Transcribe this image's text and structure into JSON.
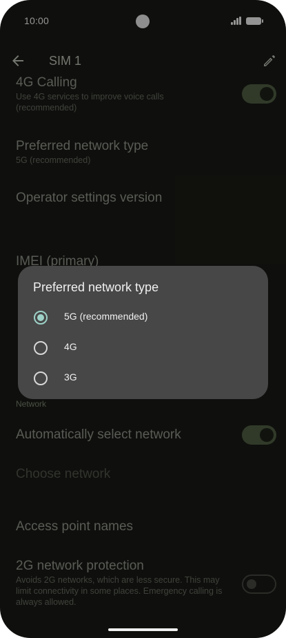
{
  "status_bar": {
    "time": "10:00"
  },
  "app_bar": {
    "title": "SIM 1",
    "back_icon": "arrow-back-icon",
    "edit_icon": "pencil-icon"
  },
  "settings": {
    "calling_4g": {
      "title": "4G Calling",
      "subtitle": "Use 4G services to improve voice calls (recommended)",
      "toggle_on": true
    },
    "preferred_network": {
      "title": "Preferred network type",
      "subtitle": "5G (recommended)"
    },
    "operator_version": {
      "title": "Operator settings version"
    },
    "imei": {
      "title": "IMEI (primary)"
    },
    "network_section": "Network",
    "auto_select": {
      "title": "Automatically select network",
      "toggle_on": true
    },
    "choose_network": {
      "title": "Choose network"
    },
    "apn": {
      "title": "Access point names"
    },
    "protection_2g": {
      "title": "2G network protection",
      "subtitle": "Avoids 2G networks, which are less secure. This may limit connectivity in some places. Emergency calling is always allowed.",
      "toggle_on": false
    }
  },
  "dialog": {
    "title": "Preferred network type",
    "options": [
      {
        "label": "5G (recommended)",
        "selected": true
      },
      {
        "label": "4G",
        "selected": false
      },
      {
        "label": "3G",
        "selected": false
      }
    ]
  },
  "colors": {
    "accent_radio": "#9ed2c8",
    "toggle_on": "#556448",
    "background": "#1b1d17",
    "dialog": "#474747"
  }
}
